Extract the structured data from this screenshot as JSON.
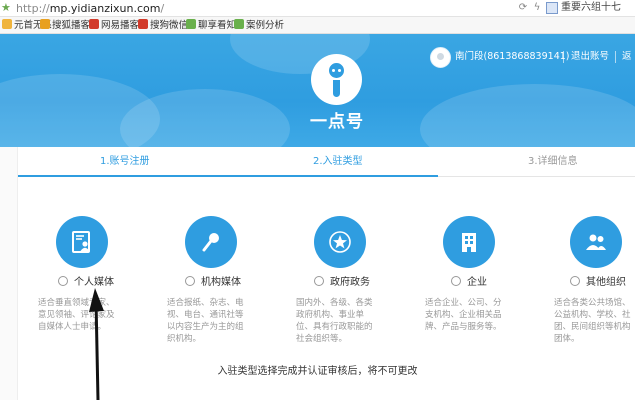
{
  "browser": {
    "url_prefix": "http://",
    "url_host": "mp.yidianzixun.com",
    "url_suffix": "/",
    "tab_title": "重要六组十七"
  },
  "bookmarks": [
    {
      "label": "元首无系",
      "color": "#f0b43c"
    },
    {
      "label": "搜狐播客",
      "color": "#e8a020"
    },
    {
      "label": "网易播客",
      "color": "#d23a2a"
    },
    {
      "label": "搜狗微信",
      "color": "#d23a2a"
    },
    {
      "label": "聊享看知",
      "color": "#6ab04c"
    },
    {
      "label": "案例分析",
      "color": "#6ab04c"
    }
  ],
  "header": {
    "brand": "一点号",
    "user": "南门段(8613868839141)",
    "logout": "退出账号",
    "more": "返"
  },
  "steps": [
    {
      "label": "1.账号注册",
      "active": true
    },
    {
      "label": "2.入驻类型",
      "active": true
    },
    {
      "label": "3.详细信息",
      "active": false
    }
  ],
  "account_types": [
    {
      "label": "个人媒体",
      "icon": "id-card-icon",
      "desc": "适合垂直领域专家、意见领袖、评论家及自媒体人士申请。"
    },
    {
      "label": "机构媒体",
      "icon": "microphone-icon",
      "desc": "适合报纸、杂志、电视、电台、通讯社等以内容生产为主的组织机构。"
    },
    {
      "label": "政府政务",
      "icon": "star-emblem-icon",
      "desc": "国内外、各级、各类政府机构、事业单位、具有行政职能的社会组织等。"
    },
    {
      "label": "企业",
      "icon": "building-icon",
      "desc": "适合企业、公司、分支机构、企业相关品牌、产品与服务等。"
    },
    {
      "label": "其他组织",
      "icon": "group-icon",
      "desc": "适合各类公共场馆、公益机构、学校、社团、民间组织等机构团体。"
    }
  ],
  "notice": "入驻类型选择完成并认证审核后，将不可更改",
  "colors": {
    "brand_blue": "#2f9de0"
  }
}
